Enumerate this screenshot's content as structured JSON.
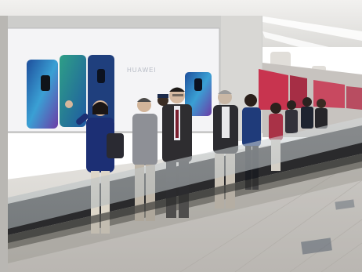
{
  "photo": {
    "billboard_brand": "HUAWEI",
    "colors": {
      "ceiling": "#e9e8e6",
      "wall": "#cfcfcd",
      "billboard_bg": "#f4f4f6",
      "phone_aurora": "#2a6fb6",
      "banner_red": "#c8344f",
      "floor": "#dedcd8",
      "walkway_rail": "#2a2a2c",
      "glass": "#bcc3c6"
    },
    "people_count": 11
  }
}
